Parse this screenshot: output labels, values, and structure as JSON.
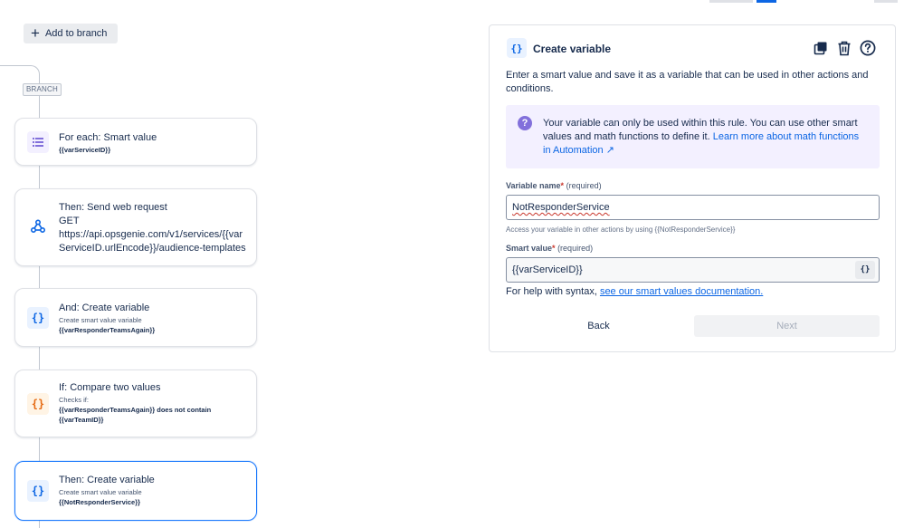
{
  "builder": {
    "add_branch_label": "Add to branch",
    "branch_tag": "BRANCH",
    "steps": [
      {
        "title": "For each: Smart value",
        "value": "{{varServiceID}}",
        "icon": "list-icon"
      },
      {
        "title": "Then: Send web request",
        "method": "GET",
        "url_line1": "https://api.opsgenie.com/v1/services/{{var",
        "url_line2": "ServiceID.urlEncode}}/audience-templates",
        "icon": "webhook-icon"
      },
      {
        "title": "And: Create variable",
        "sub": "Create smart value variable",
        "value": "{{varResponderTeamsAgain}}",
        "icon": "braces-icon"
      },
      {
        "title": "If: Compare two values",
        "sub": "Checks if:",
        "value_line1": "{{varResponderTeamsAgain}} does not contain",
        "value_line2": "{{varTeamID}}",
        "icon": "braces-icon"
      },
      {
        "title": "Then: Create variable",
        "sub": "Create smart value variable",
        "value": "{{NotResponderService}}",
        "icon": "braces-icon",
        "selected": true
      }
    ]
  },
  "panel": {
    "icon_text": "{}",
    "title": "Create variable",
    "description": "Enter a smart value and save it as a variable that can be used in other actions and conditions.",
    "info": {
      "text": "Your variable can only be used within this rule. You can use other smart values and math functions to define it.",
      "link": "Learn more about math functions in Automation ↗"
    },
    "variable_name": {
      "label": "Variable name",
      "required": "(required)",
      "value": "NotResponderService",
      "hint": "Access your variable in other actions by using {{NotResponderService}}"
    },
    "smart_value": {
      "label": "Smart value",
      "required": "(required)",
      "value": "{{varServiceID}}",
      "button": "{}"
    },
    "help_text": "For help with syntax,",
    "help_link": "see our smart values documentation.",
    "back_label": "Back",
    "next_label": "Next"
  },
  "colors": {
    "accent": "#0c66e4",
    "selected_border": "#1d7afc",
    "info_bg": "#f3f0ff",
    "info_icon": "#8270db",
    "condition_icon": "#e56910"
  }
}
